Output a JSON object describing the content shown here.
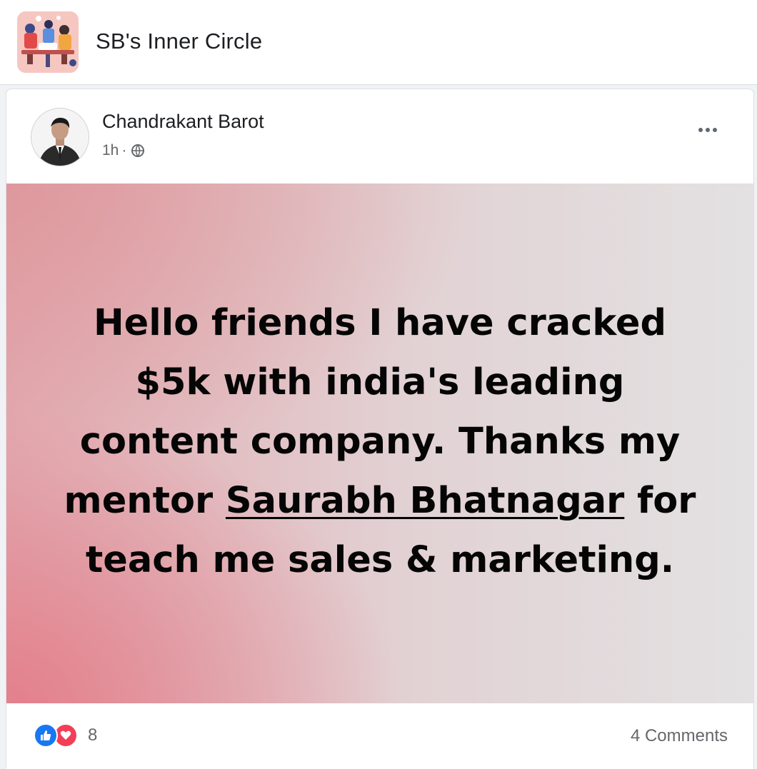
{
  "group": {
    "name": "SB's Inner Circle",
    "thumbnail_icon": "group-cover-illustration-icon"
  },
  "post": {
    "author": "Chandrakant Barot",
    "time": "1h",
    "separator": "·",
    "audience_icon": "globe-icon",
    "more_icon": "more-options-icon",
    "banner": {
      "lines": [
        "Hello friends I have cracked",
        "$5k with india's leading",
        "content company. Thanks my"
      ],
      "line4_prefix": "mentor ",
      "mention": "Saurabh Bhatnagar",
      "line4_suffix": " for",
      "line5": "teach me sales & marketing.",
      "gradient_colors": [
        "#e37e8a",
        "#e2d2d4",
        "#e3e1e2"
      ]
    },
    "reactions": {
      "icons": [
        "like-icon",
        "love-icon"
      ],
      "count": "8"
    },
    "comments_label": "4 Comments"
  },
  "colors": {
    "like": "#1877f2",
    "love": "#f33e58",
    "secondary_text": "#65676b",
    "primary_text": "#1c1e21"
  }
}
